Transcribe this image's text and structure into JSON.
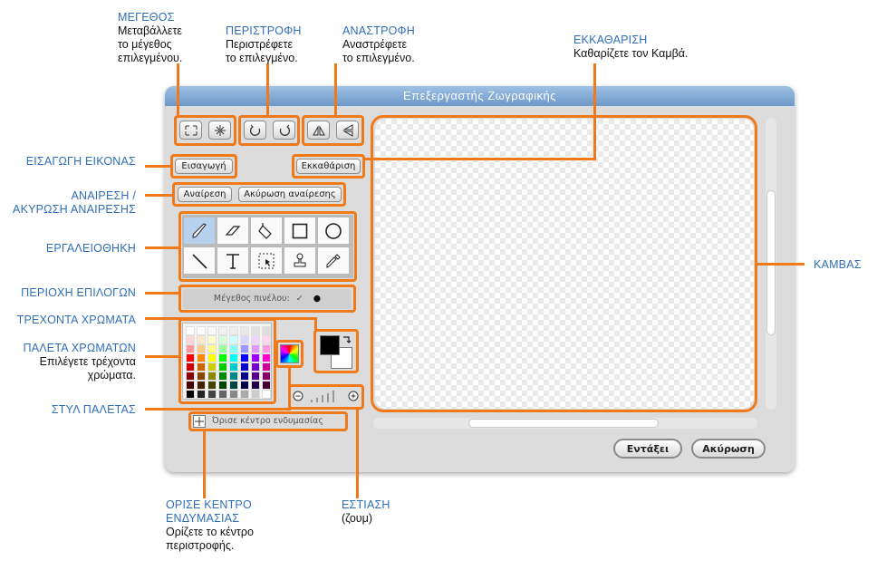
{
  "window": {
    "title": "Επεξεργαστής Ζωγραφικής"
  },
  "buttons": {
    "import": "Εισαγωγή",
    "clear": "Εκκαθάριση",
    "undo": "Αναίρεση",
    "redo": "Ακύρωση αναίρεσης",
    "ok": "Εντάξει",
    "cancel": "Ακύρωση"
  },
  "options": {
    "brush_size_label": "Μέγεθος πινέλου:"
  },
  "set_center_label": "Όρισε κέντρο ενδυμασίας",
  "tools": [
    "paintbrush-icon",
    "eraser-icon",
    "fill-bucket-icon",
    "rectangle-icon",
    "ellipse-icon",
    "line-icon",
    "text-icon",
    "select-icon",
    "stamp-icon",
    "eyedropper-icon"
  ],
  "annotations": {
    "size": {
      "title": "ΜΕΓΕΘΟΣ",
      "desc1": "Μεταβάλλετε",
      "desc2": "το μέγεθος",
      "desc3": "επιλεγμένου."
    },
    "rotate": {
      "title": "ΠΕΡΙΣΤΡΟΦΗ",
      "desc1": "Περιστρέφετε",
      "desc2": "το επιλεγμένο."
    },
    "flip": {
      "title": "ΑΝΑΣΤΡΟΦΗ",
      "desc1": "Αναστρέφετε",
      "desc2": "το επιλεγμένο."
    },
    "clear": {
      "title": "ΕΚΚΑΘΑΡΙΣΗ",
      "desc1": "Καθαρίζετε τον Καμβά."
    },
    "import": {
      "title": "ΕΙΣΑΓΩΓΗ ΕΙΚΟΝΑΣ"
    },
    "undo": {
      "title1": "ΑΝΑΙΡΕΣΗ /",
      "title2": "ΑΚΥΡΩΣΗ ΑΝΑΙΡΕΣΗΣ"
    },
    "toolbox": {
      "title": "ΕΡΓΑΛΕΙΟΘΗΚΗ"
    },
    "options": {
      "title": "ΠΕΡΙΟΧΗ ΕΠΙΛΟΓΩΝ"
    },
    "current_colors": {
      "title": "ΤΡΕΧΟΝΤΑ ΧΡΩΜΑΤΑ"
    },
    "palette": {
      "title": "ΠΑΛΕΤΑ ΧΡΩΜΑΤΩΝ",
      "desc1": "Επιλέγετε τρέχοντα",
      "desc2": "χρώματα."
    },
    "palette_style": {
      "title": "ΣΤΥΛ  ΠΑΛΕΤΑΣ"
    },
    "canvas": {
      "title": "ΚΑΜΒΑΣ"
    },
    "set_center": {
      "title1": "ΟΡΙΣΕ ΚΕΝΤΡΟ",
      "title2": "ΕΝΔΥΜΑΣΙΑΣ",
      "desc1": "Ορίζετε το κέντρο",
      "desc2": "περιστροφής."
    },
    "zoom": {
      "title": "ΕΣΤΙΑΣΗ",
      "desc1": "(ζουμ)"
    }
  },
  "colors": {
    "accent": "#f07a1a",
    "annotation": "#2f6fb7",
    "title_bar": "#7fa7d3",
    "foreground": "#000000",
    "background": "#ffffff"
  },
  "palette": [
    [
      "#ffffff",
      "#fcfcfc",
      "#f8f8f8",
      "#f0f0f0",
      "#ececec",
      "#e8e8e8",
      "#e2e2e2",
      "#dedede"
    ],
    [
      "#ffd6d6",
      "#ffe9cc",
      "#ffffcc",
      "#d6ffd6",
      "#ccffff",
      "#d6d6ff",
      "#f0d6ff",
      "#ffd6f0"
    ],
    [
      "#ff9999",
      "#ffcc88",
      "#ffff88",
      "#99ff99",
      "#88ffff",
      "#9999ff",
      "#dd99ff",
      "#ff99dd"
    ],
    [
      "#ff0000",
      "#ff8800",
      "#ffff00",
      "#00ff00",
      "#00ffff",
      "#0000ff",
      "#9900ff",
      "#ff00cc"
    ],
    [
      "#cc0000",
      "#cc6600",
      "#cccc00",
      "#00cc00",
      "#00cccc",
      "#0000cc",
      "#7700cc",
      "#cc0099"
    ],
    [
      "#880000",
      "#884400",
      "#888800",
      "#008800",
      "#008888",
      "#000088",
      "#550088",
      "#880066"
    ],
    [
      "#440000",
      "#442200",
      "#444400",
      "#004400",
      "#004444",
      "#000044",
      "#220044",
      "#440033"
    ],
    [
      "#000000",
      "#222222",
      "#444444",
      "#666666",
      "#888888",
      "#aaaaaa",
      "#cccccc",
      "#ffffff"
    ]
  ]
}
